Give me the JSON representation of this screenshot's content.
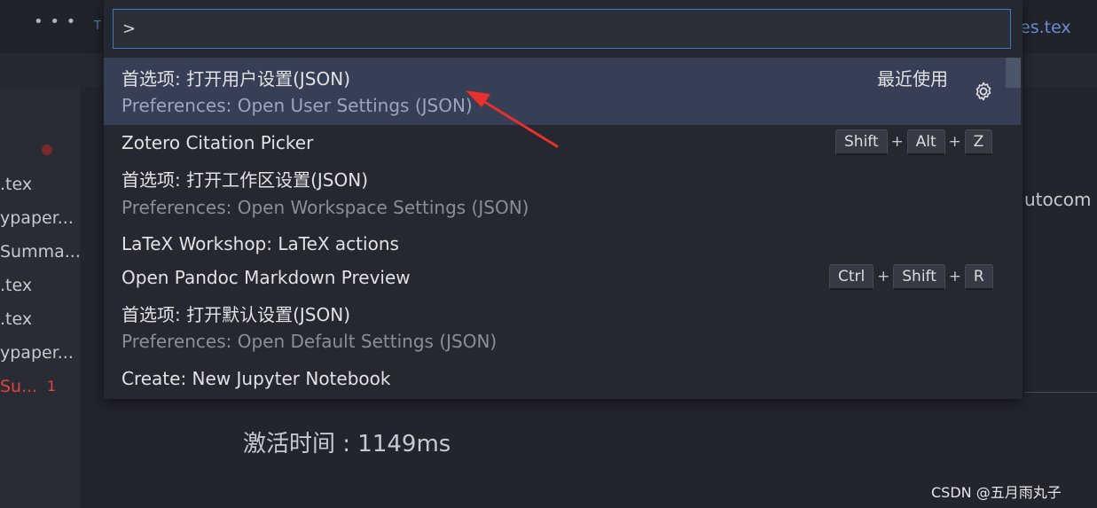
{
  "topbar": {
    "more_icon": "more-dots-icon",
    "tab_left_partial": "T",
    "tab_right_partial": "es.tex"
  },
  "sidebar": {
    "files": [
      {
        "label": ".tex",
        "error": false
      },
      {
        "label": "ypaper...",
        "error": false
      },
      {
        "label": "Summa...",
        "error": false
      },
      {
        "label": ".tex",
        "error": false
      },
      {
        "label": ".tex",
        "error": false
      },
      {
        "label": "ypaper...",
        "error": false
      },
      {
        "label": "Su...",
        "error": true
      }
    ],
    "error_badge": "1"
  },
  "editor": {
    "partial_text": "utocom",
    "activation_text": "激活时间 : 1149ms"
  },
  "palette": {
    "input_value": ">",
    "items": [
      {
        "primary": "首选项: 打开用户设置(JSON)",
        "secondary": "Preferences: Open User Settings (JSON)",
        "recent": "最近使用",
        "selected": true
      },
      {
        "primary": "Zotero Citation Picker",
        "keys": [
          "Shift",
          "Alt",
          "Z"
        ]
      },
      {
        "primary": "首选项: 打开工作区设置(JSON)",
        "secondary": "Preferences: Open Workspace Settings (JSON)"
      },
      {
        "primary": "LaTeX Workshop: LaTeX actions"
      },
      {
        "primary": "Open Pandoc Markdown Preview",
        "keys": [
          "Ctrl",
          "Shift",
          "R"
        ]
      },
      {
        "primary": "首选项: 打开默认设置(JSON)",
        "secondary": "Preferences: Open Default Settings (JSON)"
      },
      {
        "primary": "Create: New Jupyter Notebook"
      }
    ],
    "key_separator": "+"
  },
  "watermark": "CSDN @五月雨丸子",
  "colors": {
    "selection": "#363f55",
    "input_border": "#3b79c7",
    "annotation_arrow": "#e8302c",
    "error": "#e2423e"
  }
}
